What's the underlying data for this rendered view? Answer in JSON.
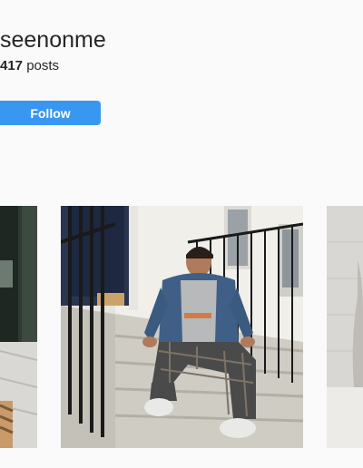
{
  "profile": {
    "username": "seenonme",
    "post_count": "417",
    "posts_label": " posts",
    "follow_label": "Follow"
  },
  "colors": {
    "follow_button": "#3897f0",
    "background": "#fafafa"
  },
  "grid": {
    "tiles": [
      {
        "name": "photo-tile-left"
      },
      {
        "name": "photo-tile-center"
      },
      {
        "name": "photo-tile-right"
      }
    ]
  }
}
